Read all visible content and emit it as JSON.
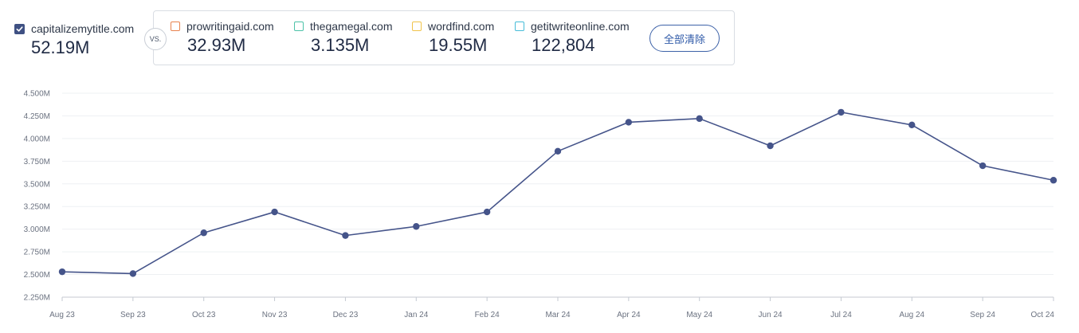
{
  "primary": {
    "domain": "capitalizemytitle.com",
    "value": "52.19M"
  },
  "vs_label": "VS.",
  "competitors": [
    {
      "domain": "prowritingaid.com",
      "value": "32.93M",
      "color": "#e8834e"
    },
    {
      "domain": "thegamegal.com",
      "value": "3.135M",
      "color": "#4cc2a8"
    },
    {
      "domain": "wordfind.com",
      "value": "19.55M",
      "color": "#f0c34a"
    },
    {
      "domain": "getitwriteonline.com",
      "value": "122,804",
      "color": "#46bcd8"
    }
  ],
  "clear_all_label": "全部清除",
  "colors": {
    "series": "#45548a",
    "checkbox": "#3f5183",
    "grid": "#eef0f3"
  },
  "chart_data": {
    "type": "line",
    "categories": [
      "Aug 23",
      "Sep 23",
      "Oct 23",
      "Nov 23",
      "Dec 23",
      "Jan 24",
      "Feb 24",
      "Mar 24",
      "Apr 24",
      "May 24",
      "Jun 24",
      "Jul 24",
      "Aug 24",
      "Sep 24",
      "Oct 24"
    ],
    "series": [
      {
        "name": "capitalizemytitle.com",
        "values": [
          2.53,
          2.51,
          2.96,
          3.19,
          2.93,
          3.03,
          3.19,
          3.86,
          4.18,
          4.22,
          3.92,
          4.29,
          4.15,
          3.7,
          3.54
        ]
      }
    ],
    "ylim": [
      2.25,
      4.5
    ],
    "y_ticks": [
      2.25,
      2.5,
      2.75,
      3.0,
      3.25,
      3.5,
      3.75,
      4.0,
      4.25,
      4.5
    ],
    "y_tick_labels": [
      "2.250M",
      "2.500M",
      "2.750M",
      "3.000M",
      "3.250M",
      "3.500M",
      "3.750M",
      "4.000M",
      "4.250M",
      "4.500M"
    ],
    "grid": true,
    "title": "",
    "xlabel": "",
    "ylabel": ""
  }
}
